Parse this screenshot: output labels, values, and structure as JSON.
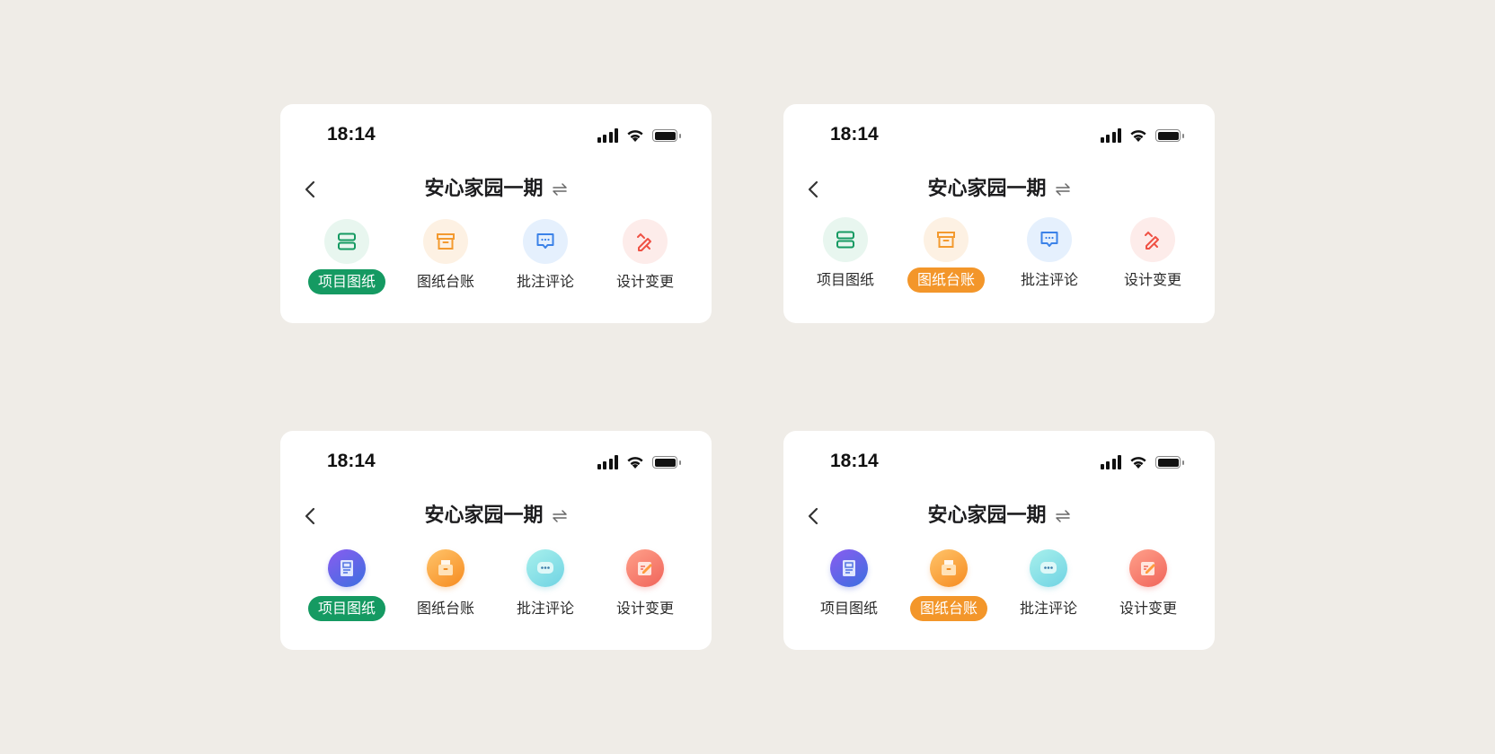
{
  "status": {
    "time": "18:14"
  },
  "nav": {
    "title": "安心家园一期"
  },
  "menu": {
    "items": [
      "项目图纸",
      "图纸台账",
      "批注评论",
      "设计变更"
    ]
  },
  "colors": {
    "background": "#efece7",
    "active_green": "#159a62",
    "active_orange": "#f3962a",
    "icon_green": "#159a62",
    "icon_orange": "#f39a2f",
    "icon_blue": "#3b82e8",
    "icon_red": "#ef5144"
  },
  "icons": [
    "drawings-icon",
    "archive-box-icon",
    "comment-icon",
    "edit-pencil-icon"
  ],
  "variants": [
    {
      "style": "flat",
      "active_index": 0,
      "active_color": "green"
    },
    {
      "style": "flat",
      "active_index": 1,
      "active_color": "orange"
    },
    {
      "style": "gradient",
      "active_index": 0,
      "active_color": "green"
    },
    {
      "style": "gradient",
      "active_index": 1,
      "active_color": "orange"
    }
  ]
}
